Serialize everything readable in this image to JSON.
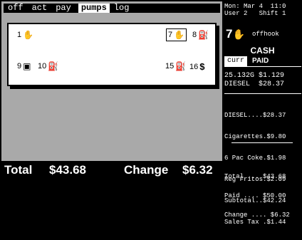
{
  "tabs": [
    "off",
    "act",
    "pay",
    "pumps",
    "log"
  ],
  "active_tab": "pumps",
  "pumps": [
    {
      "num": "1",
      "icon": "hand-icon",
      "glyph": "✋"
    },
    {
      "num": "7",
      "icon": "hand-icon",
      "glyph": "✋"
    },
    {
      "num": "8",
      "icon": "pump-icon",
      "glyph": "⛽"
    },
    {
      "num": "9",
      "icon": "nozzle-icon",
      "glyph": "▣"
    },
    {
      "num": "10",
      "icon": "pump-icon",
      "glyph": "⛽"
    },
    {
      "num": "15",
      "icon": "pump-icon",
      "glyph": "⛽"
    },
    {
      "num": "16",
      "icon": "dollar-icon",
      "glyph": "$"
    }
  ],
  "totals": {
    "total_label": "Total",
    "total_value": "$43.68",
    "change_label": "Change",
    "change_value": "$6.32"
  },
  "right": {
    "date": "Mon: Mar 4  11:0",
    "user": "User 2   Shift 1",
    "selected_pump": "7",
    "selected_pump_glyph": "✋",
    "status": "offhook",
    "tender": "CASH",
    "subtabs": [
      "curr",
      "PAID"
    ],
    "fuel_lines": [
      "25.132G $1.129",
      "DIESEL  $28.37"
    ],
    "items": [
      "DIESEL....$28.37",
      "Cigarettes.$9.80",
      "6 Pac Coke.$1.98",
      "Reg Fritos.$2.09",
      "Subtotal..$42.24",
      "Sales Tax .$1.44"
    ],
    "totals": [
      "Total ... $43.68",
      "Paid .... $50.00",
      "Change .... $6.32"
    ]
  }
}
